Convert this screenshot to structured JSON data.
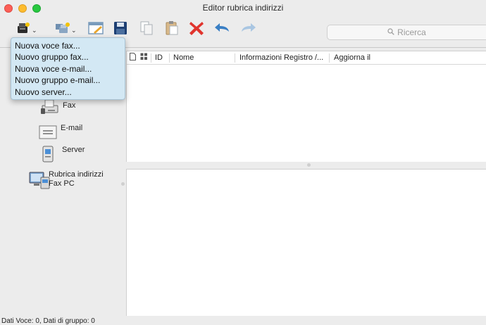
{
  "window": {
    "title": "Editor rubrica indirizzi"
  },
  "toolbar": {
    "buttons": [
      {
        "icon": "new-entry-icon",
        "has_dropdown": true
      },
      {
        "icon": "new-group-icon",
        "has_dropdown": true
      },
      {
        "icon": "edit-icon"
      },
      {
        "icon": "save-icon"
      },
      {
        "icon": "copy-icon"
      },
      {
        "icon": "paste-icon"
      },
      {
        "icon": "delete-icon"
      },
      {
        "icon": "undo-icon"
      },
      {
        "icon": "redo-icon"
      }
    ],
    "search_placeholder": "Ricerca"
  },
  "dropdown_menu": {
    "items": [
      "Nuova voce fax...",
      "Nuovo gruppo fax...",
      "Nuova voce e-mail...",
      "Nuovo gruppo e-mail...",
      "Nuovo server..."
    ]
  },
  "sidebar": {
    "items": [
      {
        "label": "Fax",
        "icon": "fax-icon"
      },
      {
        "label": "E-mail",
        "icon": "email-icon"
      },
      {
        "label": "Server",
        "icon": "server-icon"
      },
      {
        "label_line1": "Rubrica indirizzi",
        "label_line2": "Fax PC",
        "icon": "pc-fax-icon"
      }
    ]
  },
  "table": {
    "columns": [
      "ID",
      "Nome",
      "Informazioni Registro /...",
      "Aggiorna il"
    ]
  },
  "status_bar": {
    "text": "Dati Voce: 0, Dati di gruppo: 0"
  },
  "colors": {
    "menu_bg": "#d3e8f4",
    "delete_red": "#e0342d",
    "undo_blue": "#3a7fc4"
  }
}
